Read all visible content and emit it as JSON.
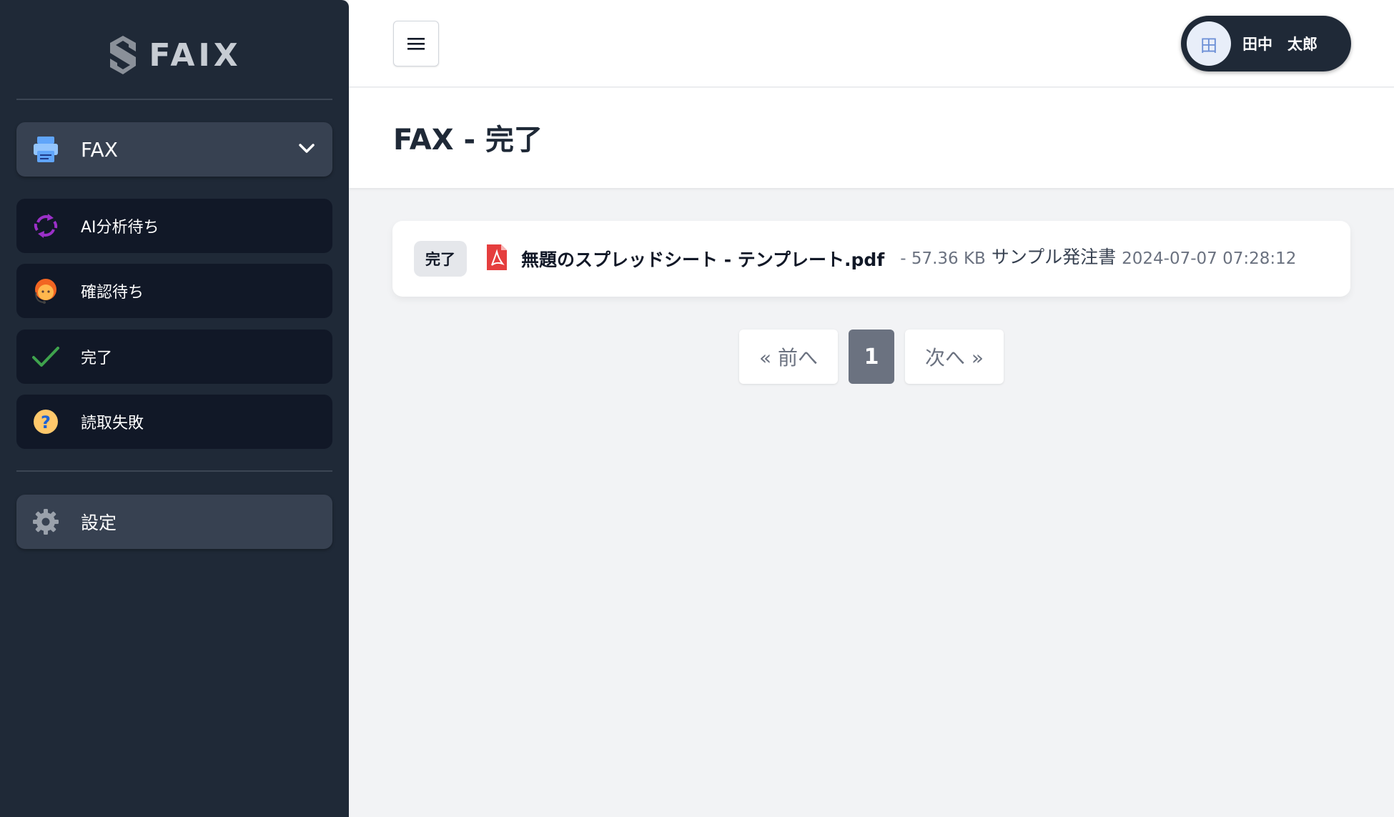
{
  "app": {
    "logo_text": "FAIX"
  },
  "sidebar": {
    "main": {
      "label": "FAX",
      "icon": "fax-icon"
    },
    "items": [
      {
        "label": "AI分析待ち",
        "icon": "refresh-icon"
      },
      {
        "label": "確認待ち",
        "icon": "operator-icon"
      },
      {
        "label": "完了",
        "icon": "check-icon"
      },
      {
        "label": "読取失敗",
        "icon": "question-icon"
      }
    ],
    "settings": {
      "label": "設定",
      "icon": "gear-icon"
    }
  },
  "header": {
    "user": {
      "name": "田中　太郎",
      "avatar_glyph": "田"
    }
  },
  "page": {
    "title": "FAX - 完了"
  },
  "files": [
    {
      "status": "完了",
      "name": "無題のスプレッドシート - テンプレート.pdf",
      "size": "- 57.36 KB",
      "description": "サンプル発注書",
      "datetime": "2024-07-07 07:28:12"
    }
  ],
  "pagination": {
    "prev": "« 前へ",
    "current": "1",
    "next": "次へ »"
  },
  "colors": {
    "sidebar_bg": "#1f2937",
    "nav_item_bg": "#111827",
    "nav_active_bg": "#374151",
    "check_green": "#3fa34d",
    "pdf_red": "#e53e3e",
    "refresh_purple": "#9b30c8"
  }
}
